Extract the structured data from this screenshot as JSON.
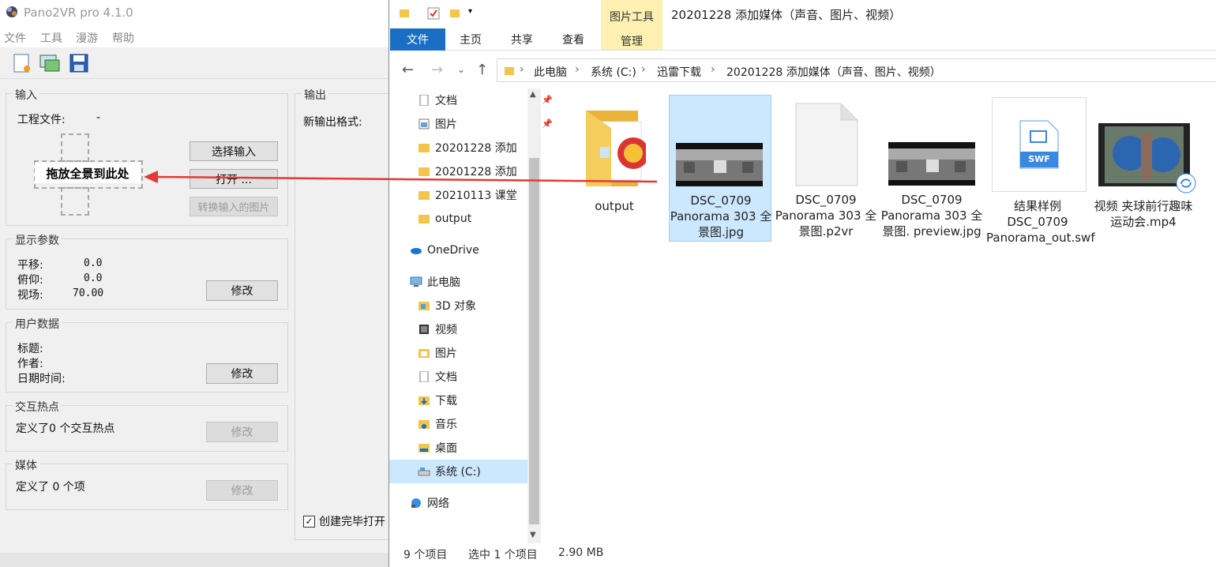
{
  "pano": {
    "title": "Pano2VR pro 4.1.0",
    "menu": [
      "文件",
      "工具",
      "漫游",
      "帮助"
    ],
    "input": {
      "group_title": "输入",
      "project_label": "工程文件:",
      "project_value": "-",
      "select_input": "选择输入",
      "open": "打开 ...",
      "convert": "转换输入的图片",
      "drop_label": "拖放全景到此处"
    },
    "output": {
      "group_title": "输出",
      "new_format": "新输出格式:",
      "open_after": "创建完毕打开"
    },
    "display": {
      "group_title": "显示参数",
      "pan_label": "平移:",
      "pan_value": "0.0",
      "tilt_label": "俯仰:",
      "tilt_value": "0.0",
      "fov_label": "视场:",
      "fov_value": "70.00",
      "modify": "修改"
    },
    "userdata": {
      "group_title": "用户数据",
      "title_label": "标题:",
      "author_label": "作者:",
      "datetime_label": "日期时间:",
      "modify": "修改"
    },
    "hotspots": {
      "group_title": "交互热点",
      "text": "定义了0 个交互热点",
      "modify": "修改"
    },
    "media": {
      "group_title": "媒体",
      "text": "定义了 0 个项",
      "modify": "修改"
    }
  },
  "explorer": {
    "context_tab": "图片工具",
    "context_sub": "管理",
    "window_title": "20201228 添加媒体（声音、图片、视频）",
    "ribbon_tabs": [
      "文件",
      "主页",
      "共享",
      "查看"
    ],
    "breadcrumb": [
      "此电脑",
      "系统 (C:)",
      "迅雷下载",
      "20201228 添加媒体（声音、图片、视频）"
    ],
    "nav_items": [
      {
        "label": "文档",
        "pinned": true
      },
      {
        "label": "图片",
        "pinned": true
      },
      {
        "label": "20201228 添加",
        "pinned": false
      },
      {
        "label": "20201228 添加",
        "pinned": false
      },
      {
        "label": "20210113 课堂",
        "pinned": false
      },
      {
        "label": "output",
        "pinned": false
      },
      {
        "label": "OneDrive",
        "pinned": false
      },
      {
        "label": "此电脑",
        "pinned": false
      },
      {
        "label": "3D 对象",
        "pinned": false
      },
      {
        "label": "视频",
        "pinned": false
      },
      {
        "label": "图片",
        "pinned": false
      },
      {
        "label": "文档",
        "pinned": false
      },
      {
        "label": "下载",
        "pinned": false
      },
      {
        "label": "音乐",
        "pinned": false
      },
      {
        "label": "桌面",
        "pinned": false
      },
      {
        "label": "系统 (C:)",
        "pinned": false
      },
      {
        "label": "网络",
        "pinned": false
      }
    ],
    "files": [
      {
        "name": "output"
      },
      {
        "name": "DSC_0709 Panorama 303 全景图.jpg"
      },
      {
        "name": "DSC_0709 Panorama 303 全景图.p2vr"
      },
      {
        "name": "DSC_0709 Panorama 303 全景图. preview.jpg"
      },
      {
        "name": "结果样例 DSC_0709 Panorama_out.swf"
      },
      {
        "name": "视频 夹球前行趣味运动会.mp4"
      }
    ],
    "swf_badge": "SWF",
    "status": {
      "count": "9 个项目",
      "selected": "选中 1 个项目",
      "size": "2.90 MB"
    }
  }
}
